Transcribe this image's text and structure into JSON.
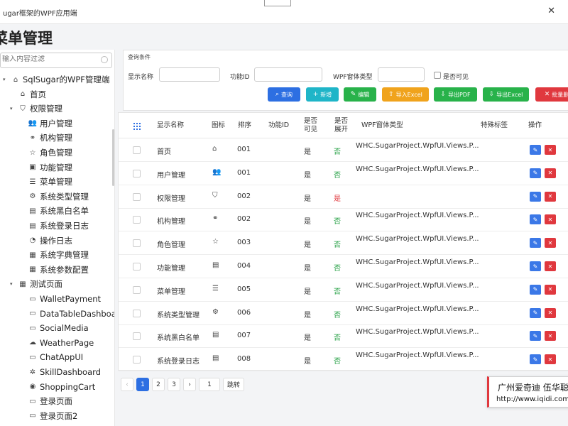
{
  "window": {
    "title": "ugar框架的WPF应用端",
    "close": "✕"
  },
  "page_title": "菜单管理",
  "sidebar": {
    "filter_placeholder": "输入内容过滤",
    "nodes": [
      {
        "label": "SqlSugar的WPF管理端",
        "icon": "⌂",
        "caret": "▾",
        "level": 0
      },
      {
        "label": "首页",
        "icon": "⌂",
        "caret": "",
        "level": 1
      },
      {
        "label": "权限管理",
        "icon": "⛉",
        "caret": "▾",
        "level": 1
      },
      {
        "label": "用户管理",
        "icon": "👥",
        "caret": "",
        "level": 2
      },
      {
        "label": "机构管理",
        "icon": "⚭",
        "caret": "",
        "level": 2
      },
      {
        "label": "角色管理",
        "icon": "☆",
        "caret": "",
        "level": 2
      },
      {
        "label": "功能管理",
        "icon": "▣",
        "caret": "",
        "level": 2
      },
      {
        "label": "菜单管理",
        "icon": "☰",
        "caret": "",
        "level": 2
      },
      {
        "label": "系统类型管理",
        "icon": "⚙",
        "caret": "",
        "level": 2
      },
      {
        "label": "系统黑白名单",
        "icon": "▤",
        "caret": "",
        "level": 2
      },
      {
        "label": "系统登录日志",
        "icon": "▤",
        "caret": "",
        "level": 2
      },
      {
        "label": "操作日志",
        "icon": "◔",
        "caret": "",
        "level": 2
      },
      {
        "label": "系统字典管理",
        "icon": "▦",
        "caret": "",
        "level": 2
      },
      {
        "label": "系统参数配置",
        "icon": "▦",
        "caret": "",
        "level": 2
      },
      {
        "label": "测试页面",
        "icon": "▦",
        "caret": "▾",
        "level": 1
      },
      {
        "label": "WalletPayment",
        "icon": "▭",
        "caret": "",
        "level": 2
      },
      {
        "label": "DataTableDashboa",
        "icon": "▭",
        "caret": "",
        "level": 2
      },
      {
        "label": "SocialMedia",
        "icon": "▭",
        "caret": "",
        "level": 2
      },
      {
        "label": "WeatherPage",
        "icon": "☁",
        "caret": "",
        "level": 2
      },
      {
        "label": "ChatAppUI",
        "icon": "▭",
        "caret": "",
        "level": 2
      },
      {
        "label": "SkillDashboard",
        "icon": "✲",
        "caret": "",
        "level": 2
      },
      {
        "label": "ShoppingCart",
        "icon": "◉",
        "caret": "",
        "level": 2
      },
      {
        "label": "登录页面",
        "icon": "▭",
        "caret": "",
        "level": 2
      },
      {
        "label": "登录页面2",
        "icon": "▭",
        "caret": "",
        "level": 2
      }
    ]
  },
  "query": {
    "title": "查询条件",
    "display_name_label": "显示名称",
    "func_id_label": "功能ID",
    "wpf_type_label": "WPF窗体类型",
    "visible_label": "是否可见",
    "buttons": [
      {
        "label": "查询",
        "icon": "⌕",
        "color": "#2d6fe2"
      },
      {
        "label": "新增",
        "icon": "+",
        "color": "#1fb5c8"
      },
      {
        "label": "编辑",
        "icon": "✎",
        "color": "#28b24a"
      },
      {
        "label": "导入Excel",
        "icon": "⇧",
        "color": "#f0a31c"
      },
      {
        "label": "导出PDF",
        "icon": "⇩",
        "color": "#28b24a"
      },
      {
        "label": "导出Excel",
        "icon": "⇩",
        "color": "#28b24a"
      },
      {
        "label": "批量删",
        "icon": "✕",
        "color": "#e0383e"
      }
    ]
  },
  "table": {
    "headers": {
      "name": "显示名称",
      "icon": "图标",
      "order": "排序",
      "func_id": "功能ID",
      "visible": "是否\n可见",
      "expand": "是否\n展开",
      "wpf_type": "WPF窗体类型",
      "tag": "特殊标签",
      "actions": "操作"
    },
    "rows": [
      {
        "name": "首页",
        "icon": "⌂",
        "order": "001",
        "visible": "是",
        "expand": "否",
        "expand_state": "green",
        "wpf_type": "WHC.SugarProject.WpfUI.Views.P..."
      },
      {
        "name": "用户管理",
        "icon": "👥",
        "order": "001",
        "visible": "是",
        "expand": "否",
        "expand_state": "green",
        "wpf_type": "WHC.SugarProject.WpfUI.Views.P..."
      },
      {
        "name": "权限管理",
        "icon": "⛉",
        "order": "002",
        "visible": "是",
        "expand": "是",
        "expand_state": "red",
        "wpf_type": ""
      },
      {
        "name": "机构管理",
        "icon": "⚭",
        "order": "002",
        "visible": "是",
        "expand": "否",
        "expand_state": "green",
        "wpf_type": "WHC.SugarProject.WpfUI.Views.P..."
      },
      {
        "name": "角色管理",
        "icon": "☆",
        "order": "003",
        "visible": "是",
        "expand": "否",
        "expand_state": "green",
        "wpf_type": "WHC.SugarProject.WpfUI.Views.P..."
      },
      {
        "name": "功能管理",
        "icon": "▤",
        "order": "004",
        "visible": "是",
        "expand": "否",
        "expand_state": "green",
        "wpf_type": "WHC.SugarProject.WpfUI.Views.P..."
      },
      {
        "name": "菜单管理",
        "icon": "☰",
        "order": "005",
        "visible": "是",
        "expand": "否",
        "expand_state": "green",
        "wpf_type": "WHC.SugarProject.WpfUI.Views.P..."
      },
      {
        "name": "系统类型管理",
        "icon": "⚙",
        "order": "006",
        "visible": "是",
        "expand": "否",
        "expand_state": "green",
        "wpf_type": "WHC.SugarProject.WpfUI.Views.P..."
      },
      {
        "name": "系统黑白名单",
        "icon": "▤",
        "order": "007",
        "visible": "是",
        "expand": "否",
        "expand_state": "green",
        "wpf_type": "WHC.SugarProject.WpfUI.Views.P..."
      },
      {
        "name": "系统登录日志",
        "icon": "▤",
        "order": "008",
        "visible": "是",
        "expand": "否",
        "expand_state": "green",
        "wpf_type": "WHC.SugarProject.WpfUI.Views.P..."
      }
    ],
    "edit_icon": "✎",
    "delete_icon": "✕"
  },
  "pager": {
    "prev": "‹",
    "pages": [
      "1",
      "2",
      "3"
    ],
    "next": "›",
    "page_input": "1",
    "goto_label": "跳转"
  },
  "watermark": {
    "line1": "广州爱奇迪 伍华聪",
    "line2": "http://www.iqidi.com"
  }
}
